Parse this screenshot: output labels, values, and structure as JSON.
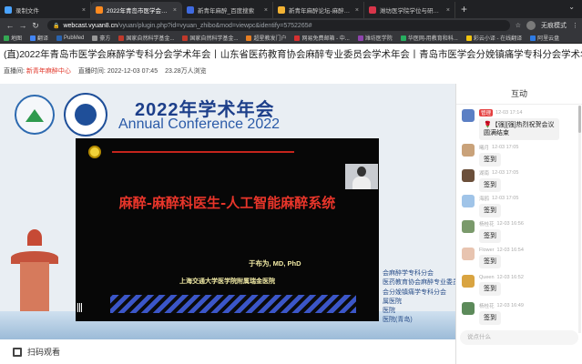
{
  "browser": {
    "tabs": [
      {
        "label": "录制文件",
        "fav_color": "#4aa3ff",
        "active": false
      },
      {
        "label": "2022年青岛市医学会麻醉学",
        "fav_color": "#ff8a1f",
        "active": true
      },
      {
        "label": "新青年麻醉_百度搜索",
        "fav_color": "#3f6ae0",
        "active": false
      },
      {
        "label": "新青年麻醉论坛-麻醉医生的网站",
        "fav_color": "#f2b233",
        "active": false
      },
      {
        "label": "潍坊医学院学位与研究生教育管",
        "fav_color": "#d8354a",
        "active": false
      }
    ],
    "new_tab": "+",
    "url_host": "webcast.vyuan8.cn",
    "url_rest": "/vyuan/plugin.php?id=vyuan_zhibo&mod=viewpc&identify=5752265#",
    "mode_label": "无痕模式",
    "bookmarks": [
      {
        "label": "地图",
        "color": "#34a853"
      },
      {
        "label": "翻译",
        "color": "#4285f4"
      },
      {
        "label": "PubMed",
        "color": "#2a64b0"
      },
      {
        "label": "豪方",
        "color": "#999999"
      },
      {
        "label": "国家自然科学基金...",
        "color": "#c0392b"
      },
      {
        "label": "国家自然科学基金...",
        "color": "#c0392b"
      },
      {
        "label": "超星教发门户",
        "color": "#e67e22"
      },
      {
        "label": "网易免费邮箱 - 中...",
        "color": "#d63031"
      },
      {
        "label": "潍坊医学院",
        "color": "#8e44ad"
      },
      {
        "label": "华医网-用教育和科...",
        "color": "#27ae60"
      },
      {
        "label": "彩云小译 - 在线翻译",
        "color": "#f1c40f"
      },
      {
        "label": "阿里云盘",
        "color": "#2d7be5"
      }
    ]
  },
  "page": {
    "title": "(直)2022年青岛市医学会麻醉学专科分会学术年会丨山东省医药教育协会麻醉专业委员会学术年会丨青岛市医学会分娩镇痛学专科分会学术年会",
    "host_label": "直播间:",
    "host_value": "新青年麻醉中心",
    "time_label": "直播时间:",
    "time_value": "2022-12-03 07:45",
    "views": "23.28万人浏览"
  },
  "video": {
    "conf_cn": "2022年学术年会",
    "conf_en": "Annual Conference 2022",
    "slide_title": "麻醉-麻醉科医生-人工智能麻醉系统",
    "slide_author": "于布为, MD, PhD",
    "slide_institution": "上海交通大学医学院附属瑞金医院",
    "right_labels": [
      "会麻醉学专科分会",
      "医药教育协会麻醉专业委员会",
      "会分娩镇痛学专科分会",
      "属医院",
      "医院",
      "医院(青岛)"
    ],
    "scan_label": "扫码观看"
  },
  "sidebar": {
    "header": "互动",
    "input_placeholder": "说点什么",
    "messages": [
      {
        "avatar_color": "#5b7fc4",
        "name": "管理",
        "badge": "管理",
        "time": "12-03 17:14",
        "text": "🌹【强][强]热烈祝贺会议圆满结束",
        "wide": true
      },
      {
        "avatar_color": "#c9a27a",
        "name": "曦月",
        "badge": "",
        "time": "12-03 17:05",
        "text": "签到",
        "wide": false
      },
      {
        "avatar_color": "#6b4f3a",
        "name": "湖南",
        "badge": "",
        "time": "12-03 17:05",
        "text": "签到",
        "wide": false
      },
      {
        "avatar_color": "#a0c4e8",
        "name": "海鸥",
        "badge": "",
        "time": "12-03 17:05",
        "text": "签到",
        "wide": false
      },
      {
        "avatar_color": "#7a9a6b",
        "name": "杨桂花",
        "badge": "",
        "time": "12-03 16:56",
        "text": "签到",
        "wide": false
      },
      {
        "avatar_color": "#e8c4b0",
        "name": "Flower",
        "badge": "",
        "time": "12-03 16:54",
        "text": "签到",
        "wide": false
      },
      {
        "avatar_color": "#d9a441",
        "name": "Queen",
        "badge": "",
        "time": "12-03 16:52",
        "text": "签到",
        "wide": false
      },
      {
        "avatar_color": "#5c8a5a",
        "name": "杨桂花",
        "badge": "",
        "time": "12-03 16:49",
        "text": "签到",
        "wide": false
      }
    ]
  }
}
